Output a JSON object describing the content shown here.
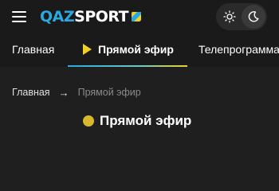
{
  "header": {
    "logo": {
      "part1": "QAZ",
      "part2": "SPORT"
    },
    "theme": {
      "light_icon": "sun-icon",
      "dark_icon": "moon-icon",
      "active": "dark"
    }
  },
  "nav": {
    "items": [
      {
        "label": "Главная"
      },
      {
        "label": "Прямой эфир",
        "active": true,
        "icon": "play-icon"
      },
      {
        "label": "Телепрограмма"
      }
    ]
  },
  "breadcrumb": {
    "home": "Главная",
    "separator": "→",
    "current": "Прямой эфир"
  },
  "main": {
    "title": "Прямой эфир"
  },
  "colors": {
    "background": "#1f1f1f",
    "header": "#1a1a1a",
    "brand_blue": "#2aa9e0",
    "accent_yellow": "#f2d024",
    "muted": "#8a8a8a"
  }
}
